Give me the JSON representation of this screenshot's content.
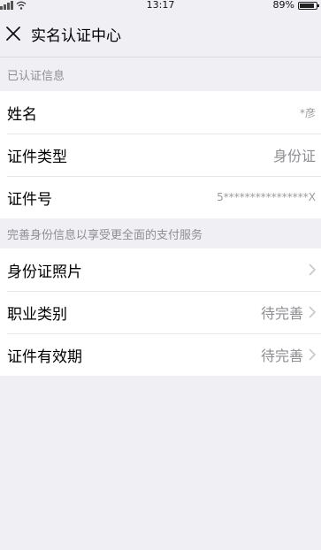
{
  "status_bar": {
    "time": "13:17",
    "battery_percent": "89%",
    "battery_level": 0.89
  },
  "nav": {
    "title": "实名认证中心",
    "close_icon": "close-icon"
  },
  "verified_section": {
    "header": "已认证信息",
    "rows": [
      {
        "label": "姓名",
        "value": "*彦"
      },
      {
        "label": "证件类型",
        "value": "身份证"
      },
      {
        "label": "证件号",
        "value": "5****************X"
      }
    ]
  },
  "complete_section": {
    "header": "完善身份信息以享受更全面的支付服务",
    "rows": [
      {
        "label": "身份证照片",
        "value": ""
      },
      {
        "label": "职业类别",
        "value": "待完善"
      },
      {
        "label": "证件有效期",
        "value": "待完善"
      }
    ],
    "chevron_icon": "chevron-right-icon"
  }
}
